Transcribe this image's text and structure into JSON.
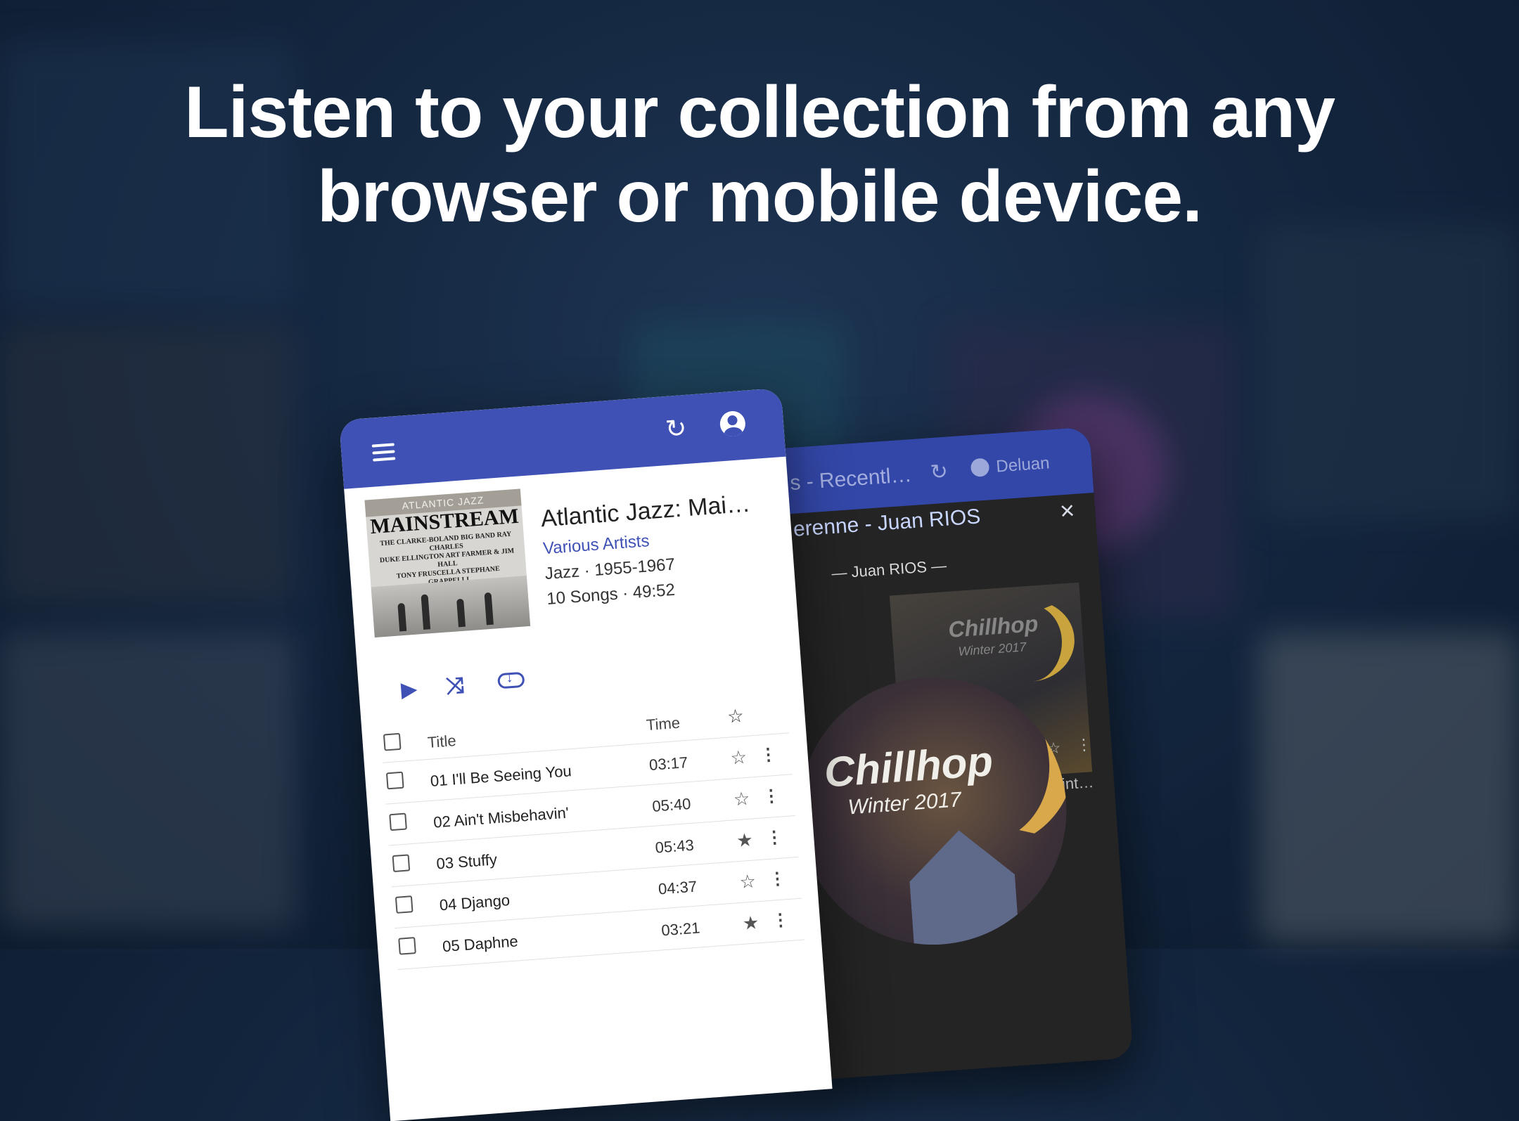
{
  "headline": {
    "line1": "Listen to your collection from any",
    "line2": "browser or mobile device."
  },
  "back_phone": {
    "title": "s - Recentl…",
    "user": "Deluan",
    "now_playing": "erenne - Juan RIOS",
    "artist_line": "—  Juan RIOS  —",
    "close_icon": "×",
    "small_cover_label": "Chillhop",
    "small_cover_sub": "Winter 2017",
    "big_cover_label": "Chillhop",
    "big_cover_sub": "Winter 2017",
    "small_cover_caption": "Wint…"
  },
  "front_phone": {
    "appbar_color": "#3f51b5",
    "album": {
      "cover_top": "ATLANTIC JAZZ",
      "cover_title": "MAINSTREAM",
      "cover_credits": "THE CLARKE-BOLAND BIG BAND  RAY CHARLES\nDUKE ELLINGTON  ART FARMER & JIM HALL\nTONY FRUSCELLA  STEPHANE GRAPPELLI\nCOLEMAN HAWKINS & MILT JACKSON\nWOODY HERMAN  THE MODERN JAZZ QUARTET\nIRA SULLIVAN",
      "title": "Atlantic Jazz: Mai…",
      "artist": "Various Artists",
      "meta1": "Jazz · 1955-1967",
      "meta2": "10 Songs · 49:52"
    },
    "table": {
      "headers": {
        "title": "Title",
        "time": "Time",
        "star": "☆"
      },
      "rows": [
        {
          "title": "01 I'll Be Seeing You",
          "time": "03:17",
          "star": "☆",
          "more": "⋮"
        },
        {
          "title": "02 Ain't Misbehavin'",
          "time": "05:40",
          "star": "☆",
          "more": "⋮"
        },
        {
          "title": "03 Stuffy",
          "time": "05:43",
          "star": "★",
          "more": "⋮"
        },
        {
          "title": "04 Django",
          "time": "04:37",
          "star": "☆",
          "more": "⋮"
        },
        {
          "title": "05 Daphne",
          "time": "03:21",
          "star": "★",
          "more": "⋮"
        }
      ]
    },
    "icons": {
      "refresh": "↻",
      "play": "▶",
      "shuffle": "⤨"
    }
  }
}
